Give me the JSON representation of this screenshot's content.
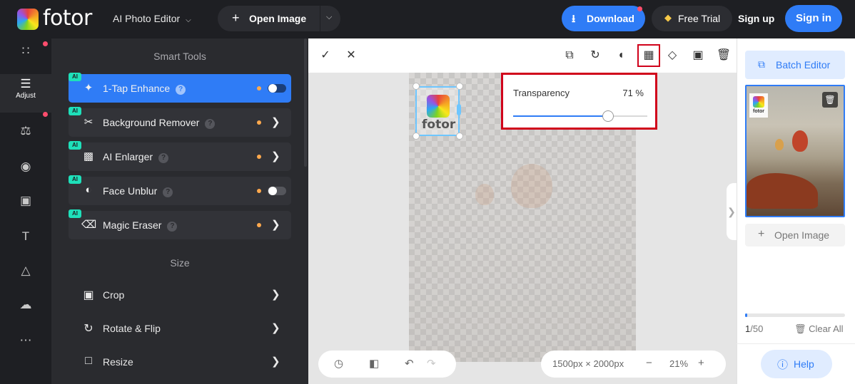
{
  "header": {
    "logo_text": "fotor",
    "editor_menu": "AI Photo Editor",
    "open_image": "Open Image",
    "download": "Download",
    "free_trial": "Free Trial",
    "sign_up": "Sign up",
    "sign_in": "Sign in"
  },
  "rail": {
    "active_label": "Adjust",
    "items": [
      "apps-icon",
      "adjust-icon",
      "beauty-icon",
      "eye-icon",
      "frame-icon",
      "text-icon",
      "elements-icon",
      "upload-icon",
      "more-icon"
    ]
  },
  "panel": {
    "smart_tools_title": "Smart Tools",
    "size_title": "Size",
    "ai_badge": "AI",
    "help_glyph": "?",
    "smart_tools": [
      {
        "label": "1-Tap Enhance"
      },
      {
        "label": "Background Remover"
      },
      {
        "label": "AI Enlarger"
      },
      {
        "label": "Face Unblur"
      },
      {
        "label": "Magic Eraser"
      }
    ],
    "size_tools": [
      {
        "label": "Crop"
      },
      {
        "label": "Rotate & Flip"
      },
      {
        "label": "Resize"
      }
    ]
  },
  "canvas": {
    "sticker_text": "fotor",
    "transparency": {
      "label": "Transparency",
      "value_text": "71 %",
      "value": 71
    },
    "dimensions": "1500px × 2000px",
    "zoom": "21%"
  },
  "right_panel": {
    "batch_editor": "Batch Editor",
    "thumb_logo_text": "fotor",
    "open_image": "Open Image",
    "count_current": "1",
    "count_total": "/50",
    "count_fraction": 0.02,
    "clear_all": "Clear All",
    "help": "Help"
  },
  "colors": {
    "accent": "#2f7cf6",
    "highlight_border": "#d0021b",
    "ai_badge": "#1ee0ba",
    "notification_dot": "#ff4d6d"
  }
}
